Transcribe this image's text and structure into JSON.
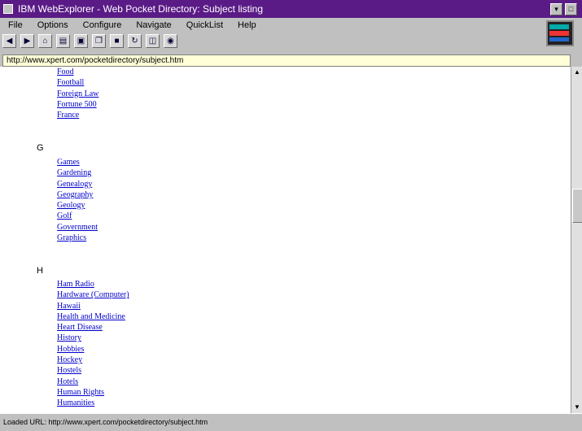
{
  "window": {
    "title": "IBM WebExplorer  -  Web Pocket Directory: Subject listing",
    "minimize_label": "▾",
    "close_label": "□"
  },
  "menu": [
    "File",
    "Options",
    "Configure",
    "Navigate",
    "QuickList",
    "Help"
  ],
  "toolbar_icons": [
    "back-icon",
    "forward-icon",
    "home-icon",
    "bookmark-icon",
    "print-icon",
    "copy-icon",
    "stop-icon",
    "refresh-icon",
    "clone-icon",
    "load-icon"
  ],
  "address": "http://www.xpert.com/pocketdirectory/subject.htm",
  "content": {
    "group_f_links": [
      "Food",
      "Football",
      "Foreign Law",
      "Fortune 500",
      "France"
    ],
    "group_g_letter": "G",
    "group_g_links": [
      "Games",
      "Gardening",
      "Genealogy",
      "Geography",
      "Geology",
      "Golf",
      "Government",
      "Graphics"
    ],
    "group_h_letter": "H",
    "group_h_links": [
      "Ham Radio",
      "Hardware (Computer)",
      "Hawaii",
      "Health and Medicine",
      "Heart Disease",
      "History",
      "Hobbies",
      "Hockey",
      "Hostels",
      "Hotels",
      "Human Rights",
      "Humanities"
    ]
  },
  "status": "Loaded URL:  http://www.xpert.com/pocketdirectory/subject.htm"
}
